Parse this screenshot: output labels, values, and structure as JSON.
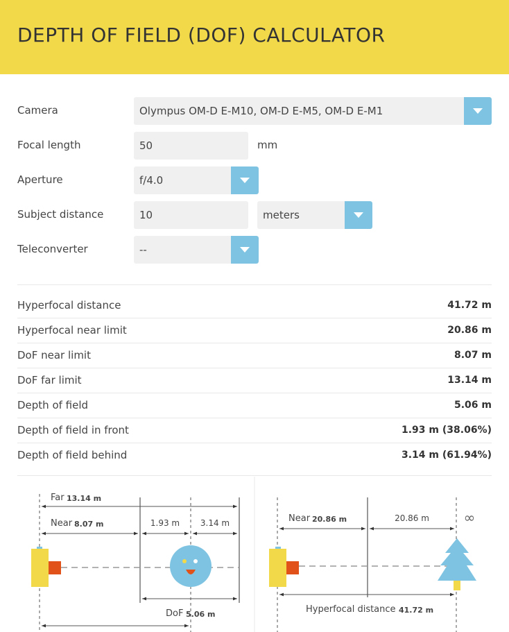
{
  "header": {
    "title": "DEPTH OF FIELD (DOF) CALCULATOR"
  },
  "form": {
    "camera": {
      "label": "Camera",
      "value": "Olympus OM-D E-M10, OM-D E-M5, OM-D E-M1"
    },
    "focal_length": {
      "label": "Focal length",
      "value": "50",
      "unit": "mm"
    },
    "aperture": {
      "label": "Aperture",
      "value": "f/4.0"
    },
    "subject_distance": {
      "label": "Subject distance",
      "value": "10",
      "unit": "meters"
    },
    "teleconverter": {
      "label": "Teleconverter",
      "value": "--"
    }
  },
  "results": [
    {
      "label": "Hyperfocal distance",
      "value": "41.72 m"
    },
    {
      "label": "Hyperfocal near limit",
      "value": "20.86 m"
    },
    {
      "label": "DoF near limit",
      "value": "8.07 m"
    },
    {
      "label": "DoF far limit",
      "value": "13.14 m"
    },
    {
      "label": "Depth of field",
      "value": "5.06 m"
    },
    {
      "label": "Depth of field in front",
      "value": "1.93 m (38.06%)"
    },
    {
      "label": "Depth of field behind",
      "value": "3.14 m (61.94%)"
    }
  ],
  "diagram_left": {
    "far_label": "Far",
    "far_value": "13.14 m",
    "near_label": "Near",
    "near_value": "8.07 m",
    "front_value": "1.93 m",
    "behind_value": "3.14 m",
    "dof_label": "DoF",
    "dof_value": "5.06 m"
  },
  "diagram_right": {
    "near_label": "Near",
    "near_value": "20.86 m",
    "mid_value": "20.86 m",
    "infinity": "∞",
    "hyper_label": "Hyperfocal distance",
    "hyper_value": "41.72 m"
  },
  "colors": {
    "accent": "#f2d94a",
    "dropdown": "#7ec4e2",
    "orange": "#e0521a",
    "tree": "#7ec4e2"
  }
}
